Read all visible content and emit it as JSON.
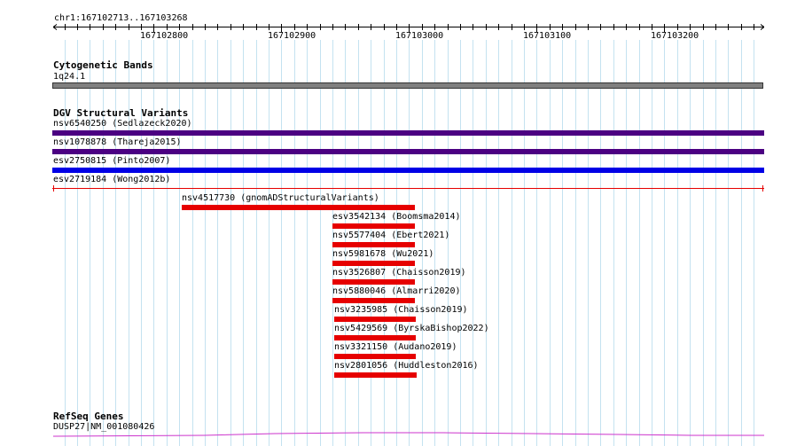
{
  "ruler": {
    "region_label": "chr1:167102713..167103268",
    "ticks": [
      "167102800",
      "167102900",
      "167103000",
      "167103100",
      "167103200"
    ]
  },
  "cytoband": {
    "title": "Cytogenetic Bands",
    "band_label": "1q24.1",
    "band_color": "#808080"
  },
  "dgv": {
    "title": "DGV Structural Variants",
    "features": [
      {
        "label": "nsv6540250 (Sedlazeck2020)",
        "color": "#4b0082"
      },
      {
        "label": "nsv1078878 (Thareja2015)",
        "color": "#4b0082"
      },
      {
        "label": "esv2750815 (Pinto2007)",
        "color": "#0000e6"
      },
      {
        "label": "esv2719184 (Wong2012b)",
        "color": "#e60000"
      },
      {
        "label": "nsv4517730 (gnomADStructuralVariants)",
        "color": "#e60000"
      },
      {
        "label": "esv3542134 (Boomsma2014)",
        "color": "#e60000"
      },
      {
        "label": "nsv5577404 (Ebert2021)",
        "color": "#e60000"
      },
      {
        "label": "nsv5981678 (Wu2021)",
        "color": "#e60000"
      },
      {
        "label": "nsv3526807 (Chaisson2019)",
        "color": "#e60000"
      },
      {
        "label": "nsv5880046 (Almarri2020)",
        "color": "#e60000"
      },
      {
        "label": "nsv3235985 (Chaisson2019)",
        "color": "#e60000"
      },
      {
        "label": "nsv5429569 (ByrskaBishop2022)",
        "color": "#e60000"
      },
      {
        "label": "nsv3321150 (Audano2019)",
        "color": "#e60000"
      },
      {
        "label": "nsv2801056 (Huddleston2016)",
        "color": "#e60000"
      }
    ]
  },
  "refseq": {
    "title": "RefSeq Genes",
    "gene_label": "DUSP27|NM_001080426",
    "gene_color": "#cc33cc"
  }
}
